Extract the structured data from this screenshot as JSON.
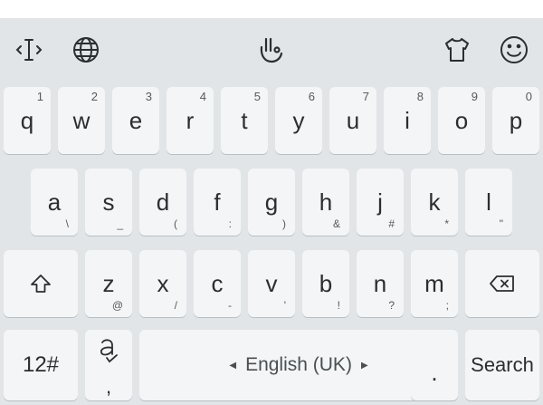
{
  "toolbar": {
    "icons": [
      "cursor-edit-icon",
      "globe-icon",
      "swipe-gesture-icon",
      "theme-shirt-icon",
      "emoji-smiley-icon"
    ]
  },
  "row1": [
    {
      "letter": "q",
      "hint": "1"
    },
    {
      "letter": "w",
      "hint": "2"
    },
    {
      "letter": "e",
      "hint": "3"
    },
    {
      "letter": "r",
      "hint": "4"
    },
    {
      "letter": "t",
      "hint": "5"
    },
    {
      "letter": "y",
      "hint": "6"
    },
    {
      "letter": "u",
      "hint": "7"
    },
    {
      "letter": "i",
      "hint": "8"
    },
    {
      "letter": "o",
      "hint": "9"
    },
    {
      "letter": "p",
      "hint": "0"
    }
  ],
  "row2": [
    {
      "letter": "a",
      "sub": "\\"
    },
    {
      "letter": "s",
      "sub": "_"
    },
    {
      "letter": "d",
      "sub": "("
    },
    {
      "letter": "f",
      "sub": ":"
    },
    {
      "letter": "g",
      "sub": ")"
    },
    {
      "letter": "h",
      "sub": "&"
    },
    {
      "letter": "j",
      "sub": "#"
    },
    {
      "letter": "k",
      "sub": "*"
    },
    {
      "letter": "l",
      "sub": "\""
    }
  ],
  "row3": [
    {
      "letter": "z",
      "sub": "@"
    },
    {
      "letter": "x",
      "sub": "/"
    },
    {
      "letter": "c",
      "sub": "-"
    },
    {
      "letter": "v",
      "sub": "'"
    },
    {
      "letter": "b",
      "sub": "!"
    },
    {
      "letter": "n",
      "sub": "?"
    },
    {
      "letter": "m",
      "sub": ";"
    }
  ],
  "row4": {
    "numbers_label": "12#",
    "comma_sub": ",",
    "space_label": "English (UK)",
    "period_label": ".",
    "action_label": "Search"
  },
  "colors": {
    "keyboard_bg": "#e2e5e7",
    "key_bg": "#f3f5f6",
    "key_text": "#2b2e31"
  }
}
